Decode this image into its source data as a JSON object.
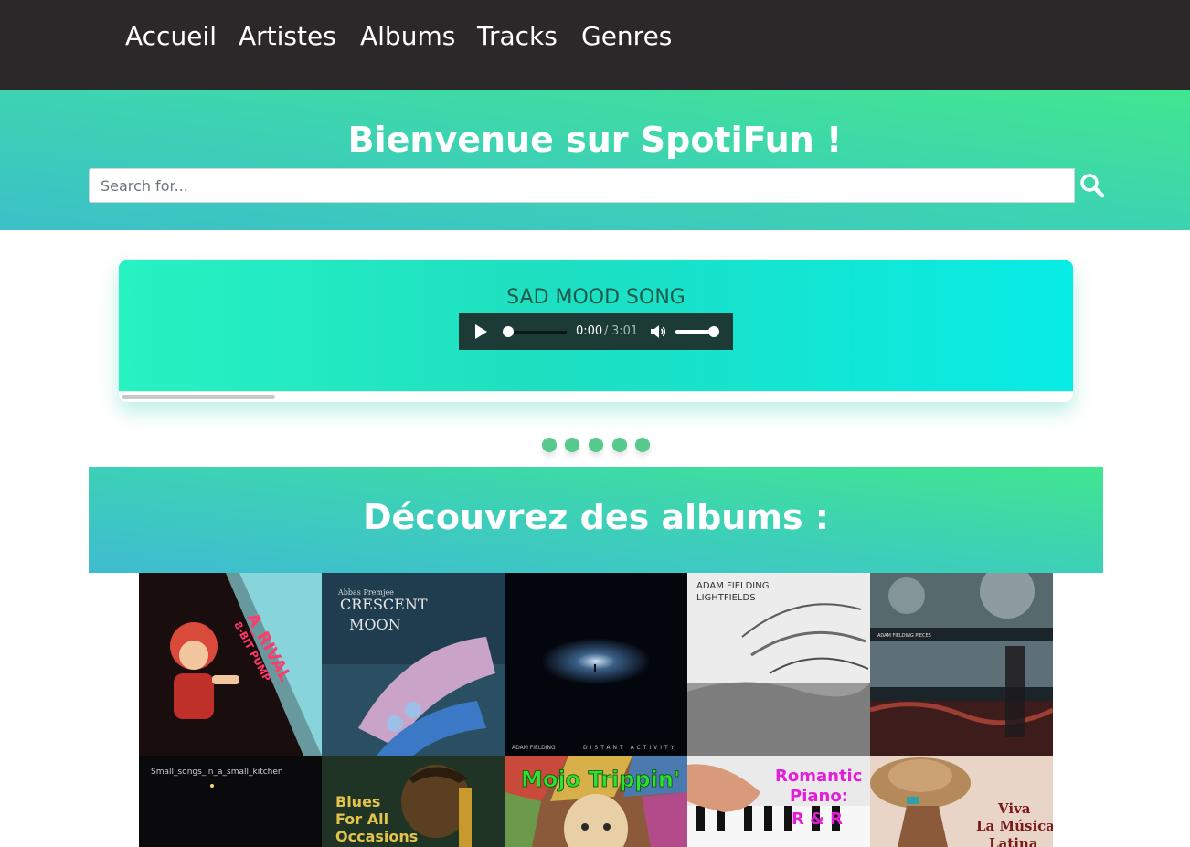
{
  "nav": {
    "items": [
      {
        "label": "Accueil"
      },
      {
        "label": "Artistes"
      },
      {
        "label": "Albums"
      },
      {
        "label": "Tracks"
      },
      {
        "label": "Genres"
      }
    ]
  },
  "hero": {
    "title": "Bienvenue sur SpotiFun !",
    "search_placeholder": "Search for...",
    "search_icon": "search-icon"
  },
  "player": {
    "song_title": "SAD MOOD SONG",
    "current_time": "0:00",
    "separator": "/",
    "duration": "3:01",
    "progress": 0,
    "volume": 1.0,
    "carousel_slide_count": 5
  },
  "albums_section": {
    "title": "Découvrez des albums :",
    "albums": [
      {
        "cover_text": [
          "A_RIVAL",
          "8-BIT PUMP"
        ]
      },
      {
        "cover_text": [
          "Abbas Premjee",
          "CRESCENT",
          "MOON"
        ]
      },
      {
        "cover_text": [
          "ADAM FIELDING",
          "DISTANT ACTIVITY"
        ]
      },
      {
        "cover_text": [
          "ADAM FIELDING",
          "LIGHTFIELDS"
        ]
      },
      {
        "cover_text": [
          "ADAM FIELDING PIECES"
        ]
      },
      {
        "cover_text": [
          "Small_songs_in_a_small_kitchen"
        ]
      },
      {
        "cover_text": [
          "Blues",
          "For All",
          "Occasions"
        ]
      },
      {
        "cover_text": [
          "Mojo Trippin'"
        ]
      },
      {
        "cover_text": [
          "Romantic",
          "Piano:",
          "R & R"
        ]
      },
      {
        "cover_text": [
          "Viva",
          "La Música",
          "Latina"
        ]
      }
    ]
  },
  "colors": {
    "navbar_bg": "#2b2829",
    "hero_gradient": [
      "#3cc0c8",
      "#40e690"
    ],
    "player_gradient": [
      "#27f2c2",
      "#08ece6"
    ],
    "dot_color": "#56c98c"
  }
}
